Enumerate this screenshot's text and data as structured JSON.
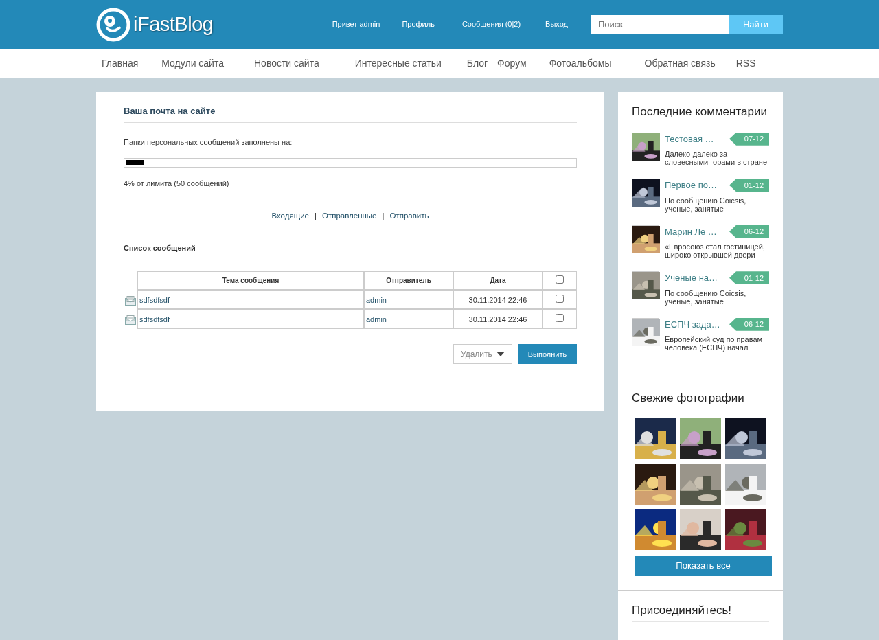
{
  "header": {
    "logo": "iFastBlog",
    "links": [
      "Привет admin",
      "Профиль",
      "Сообщения (0|2)",
      "Выход"
    ],
    "search": {
      "placeholder": "Поиск",
      "button": "Найти"
    }
  },
  "nav": [
    "Главная",
    "Модули сайта",
    "Новости сайта",
    "Интересные статьи",
    "Блог",
    "Форум",
    "Фотоальбомы",
    "Обратная связь",
    "RSS"
  ],
  "mail": {
    "title": "Ваша почта на сайте",
    "quota_label": "Папки персональных сообщений заполнены на:",
    "quota": {
      "level": 0.04
    },
    "quota_text": "4% от лимита (50 сообщений)",
    "folders": [
      "Входящие",
      "Отправленные",
      "Отправить"
    ],
    "folder_separator": "|",
    "list_title": "Список сообщений",
    "columns": [
      "Тема сообщения",
      "Отправитель",
      "Дата"
    ],
    "select_all": {
      "checked": false
    },
    "rows": [
      {
        "subject": "sdfsdfsdf",
        "sender": "admin",
        "date": "30.11.2014 22:46",
        "checked": false
      },
      {
        "subject": "sdfsdfsdf",
        "sender": "admin",
        "date": "30.11.2014 22:46",
        "checked": false
      }
    ],
    "action": "Удалить",
    "submit": "Выполнить"
  },
  "sidebar": {
    "comments_title": "Последние комментарии",
    "comments": [
      {
        "title": "Тестовая …",
        "date": "07-12",
        "text": "Далеко-далеко за словесными горами в стране"
      },
      {
        "title": "Первое по…",
        "date": "01-12",
        "text": "По сообщению Coicsis, ученые, занятые"
      },
      {
        "title": "Марин Ле …",
        "date": "06-12",
        "text": "«Евросоюз стал гостиницей, широко открывшей двери"
      },
      {
        "title": "Ученые на…",
        "date": "01-12",
        "text": "По сообщению Coicsis, ученые, занятые"
      },
      {
        "title": "ЕСПЧ зада…",
        "date": "06-12",
        "text": "Европейский суд по правам человека (ЕСПЧ) начал"
      }
    ],
    "photos_title": "Свежие фотографии",
    "show_all": "Показать все",
    "join_title": "Присоединяйтесь!"
  }
}
